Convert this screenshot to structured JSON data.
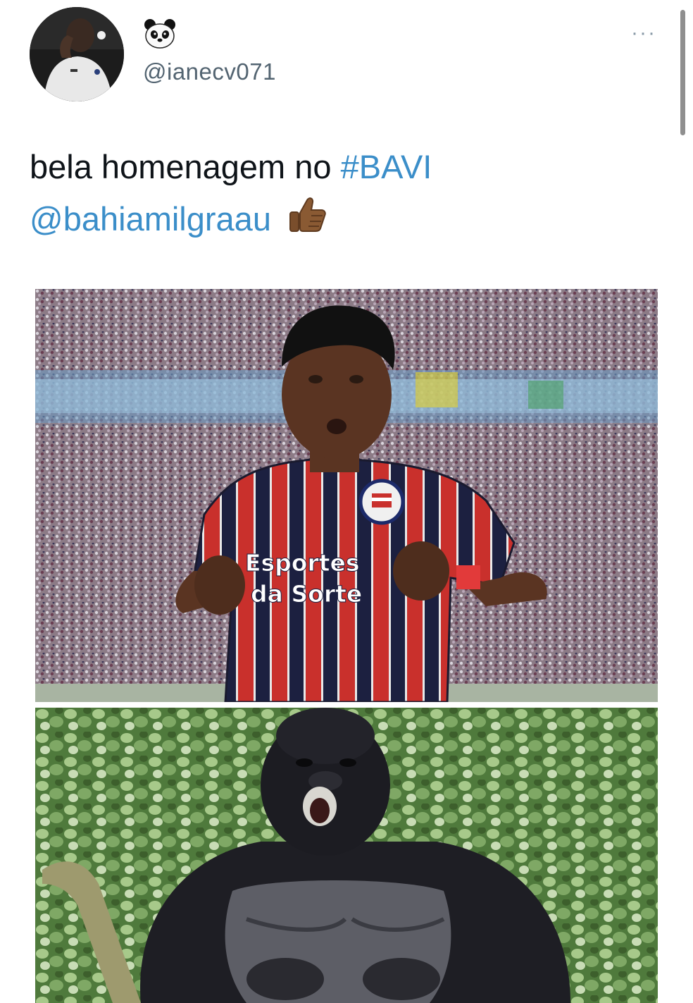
{
  "tweet": {
    "display_name": "🐼",
    "handle": "@ianecv071",
    "more_label": "···",
    "text_plain": "bela homenagem no ",
    "hashtag": "#BAVI",
    "mention": "@bahiamilgraau",
    "emoji_name": "thumbs-up-dark-skin-tone"
  },
  "media": [
    {
      "kind": "photo",
      "name": "footballer-chest-pose",
      "jersey_sponsor_line1": "Esportes",
      "jersey_sponsor_line2": "da Sorte"
    },
    {
      "kind": "photo",
      "name": "gorilla-chest-pose"
    }
  ],
  "colors": {
    "link": "#3b8ec9",
    "text": "#0f1419",
    "handle": "#536471"
  }
}
